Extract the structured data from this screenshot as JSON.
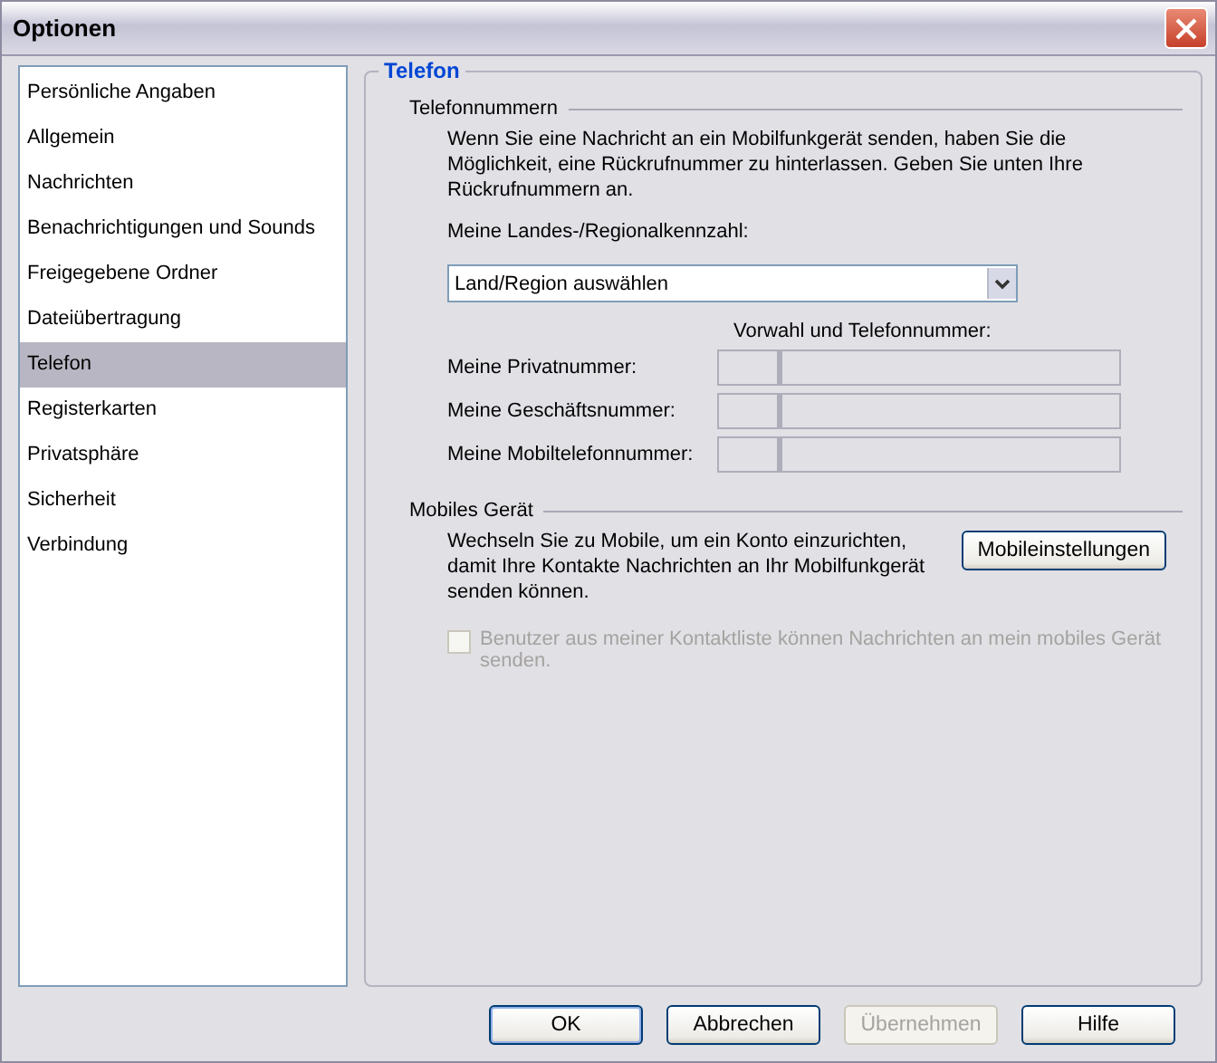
{
  "window": {
    "title": "Optionen"
  },
  "sidebar": {
    "items": [
      {
        "label": "Persönliche Angaben",
        "selected": false
      },
      {
        "label": "Allgemein",
        "selected": false
      },
      {
        "label": "Nachrichten",
        "selected": false
      },
      {
        "label": "Benachrichtigungen und Sounds",
        "selected": false
      },
      {
        "label": "Freigegebene Ordner",
        "selected": false
      },
      {
        "label": "Dateiübertragung",
        "selected": false
      },
      {
        "label": "Telefon",
        "selected": true
      },
      {
        "label": "Registerkarten",
        "selected": false
      },
      {
        "label": "Privatsphäre",
        "selected": false
      },
      {
        "label": "Sicherheit",
        "selected": false
      },
      {
        "label": "Verbindung",
        "selected": false
      }
    ]
  },
  "panel": {
    "title": "Telefon",
    "phone_numbers": {
      "heading": "Telefonnummern",
      "description": "Wenn Sie eine Nachricht an ein Mobilfunkgerät senden, haben Sie die Möglichkeit, eine Rückrufnummer zu hinterlassen. Geben Sie unten Ihre Rückrufnummern an.",
      "region_label": "Meine Landes-/Regionalkennzahl:",
      "region_select": {
        "value": "Land/Region auswählen"
      },
      "number_header": "Vorwahl und Telefonnummer:",
      "rows": [
        {
          "label": "Meine Privatnummer:"
        },
        {
          "label": "Meine Geschäftsnummer:"
        },
        {
          "label": "Meine Mobiltelefonnummer:"
        }
      ]
    },
    "mobile": {
      "heading": "Mobiles Gerät",
      "description": "Wechseln Sie zu Mobile, um ein Konto einzurichten, damit Ihre Kontakte Nachrichten an Ihr Mobilfunkgerät senden können.",
      "button": "Mobileinstellungen",
      "checkbox": {
        "label": "Benutzer aus meiner Kontaktliste können Nachrichten an mein mobiles Gerät senden.",
        "checked": false,
        "disabled": true
      }
    }
  },
  "buttons": [
    {
      "label": "OK",
      "disabled": false,
      "default": true
    },
    {
      "label": "Abbrechen",
      "disabled": false,
      "default": false
    },
    {
      "label": "Übernehmen",
      "disabled": true,
      "default": false
    },
    {
      "label": "Hilfe",
      "disabled": false,
      "default": false
    }
  ]
}
